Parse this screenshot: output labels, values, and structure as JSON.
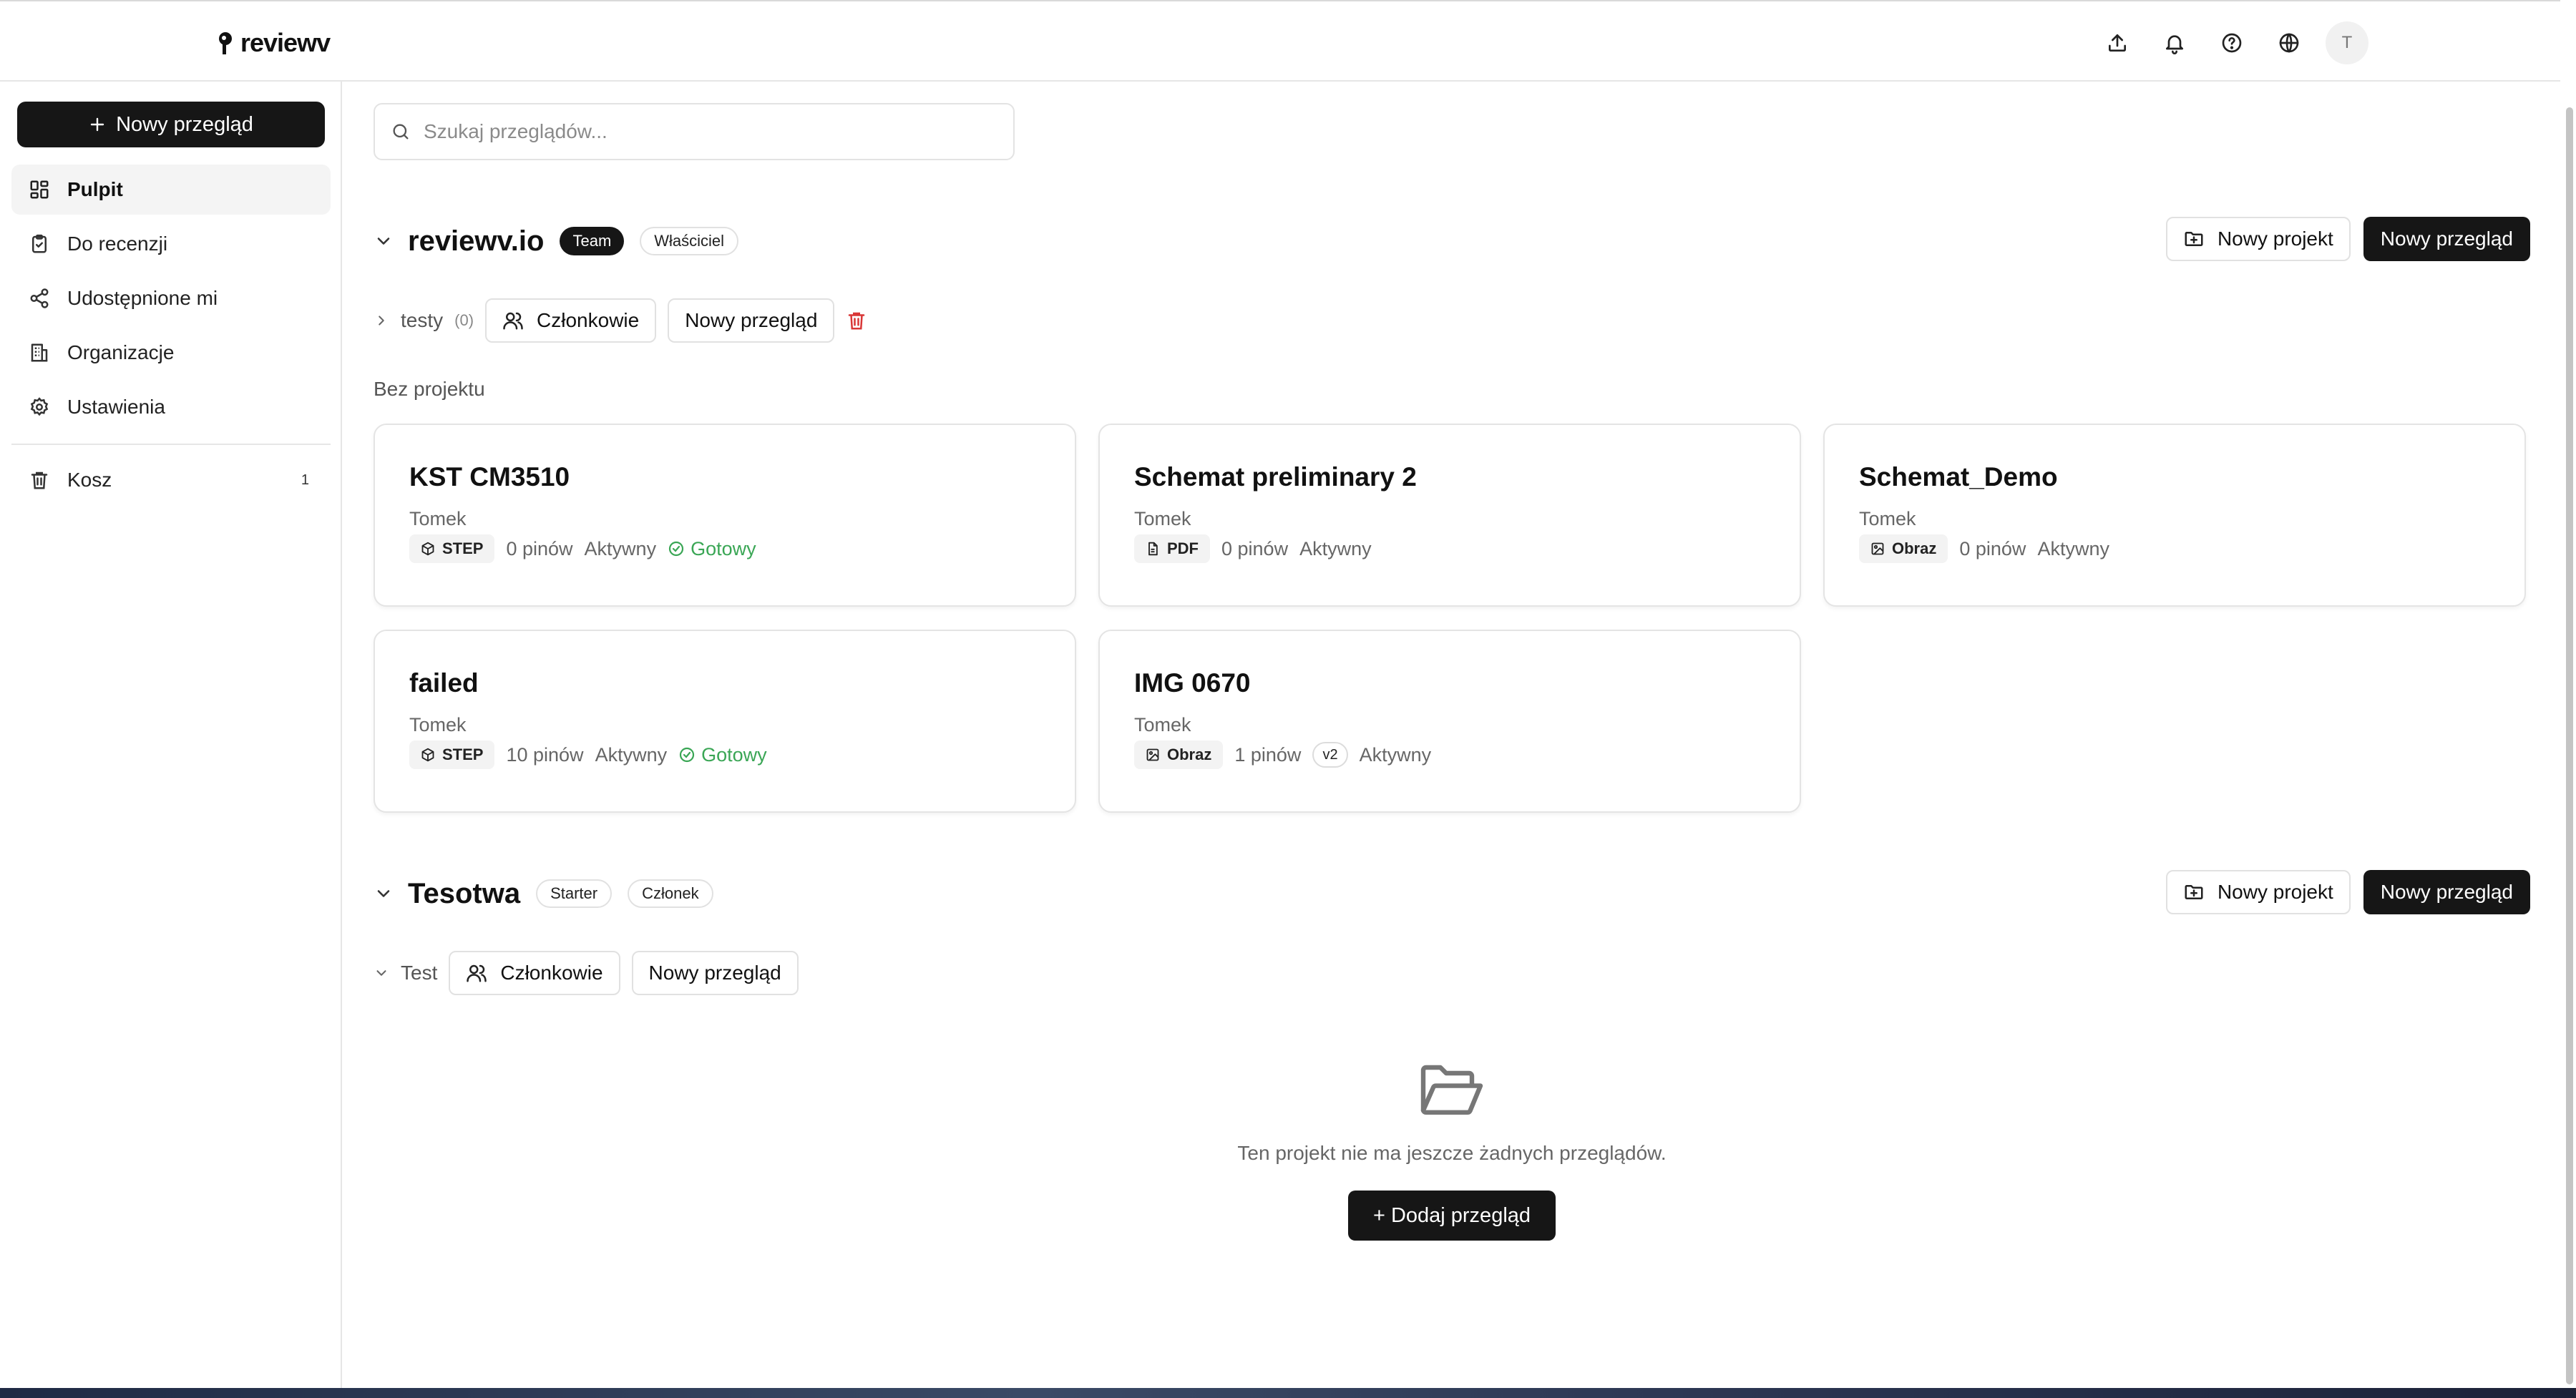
{
  "app": {
    "logo_text": "reviewv"
  },
  "header": {
    "avatar_initial": "T"
  },
  "sidebar": {
    "new_review_label": "Nowy przegląd",
    "items": [
      {
        "label": "Pulpit",
        "icon": "dashboard-icon",
        "active": true
      },
      {
        "label": "Do recenzji",
        "icon": "clipboard-icon"
      },
      {
        "label": "Udostępnione mi",
        "icon": "share-icon"
      },
      {
        "label": "Organizacje",
        "icon": "building-icon"
      },
      {
        "label": "Ustawienia",
        "icon": "gear-icon"
      }
    ],
    "trash": {
      "label": "Kosz",
      "count": "1",
      "icon": "trash-icon"
    }
  },
  "search": {
    "placeholder": "Szukaj przeglądów..."
  },
  "orgs": [
    {
      "name": "reviewv.io",
      "plan": "Team",
      "role": "Właściciel",
      "new_project_label": "Nowy projekt",
      "new_review_label": "Nowy przegląd",
      "project": {
        "name": "testy",
        "count": "(0)",
        "members_label": "Członkowie",
        "new_review_label": "Nowy przegląd"
      },
      "section_label": "Bez projektu",
      "cards": [
        {
          "title": "KST CM3510",
          "owner": "Tomek",
          "type": "STEP",
          "pins": "0 pinów",
          "status": "Aktywny",
          "ready": "Gotowy"
        },
        {
          "title": "Schemat preliminary 2",
          "owner": "Tomek",
          "type": "PDF",
          "pins": "0 pinów",
          "status": "Aktywny"
        },
        {
          "title": "Schemat_Demo",
          "owner": "Tomek",
          "type": "Obraz",
          "pins": "0 pinów",
          "status": "Aktywny"
        },
        {
          "title": "failed",
          "owner": "Tomek",
          "type": "STEP",
          "pins": "10 pinów",
          "status": "Aktywny",
          "ready": "Gotowy"
        },
        {
          "title": "IMG 0670",
          "owner": "Tomek",
          "type": "Obraz",
          "pins": "1 pinów",
          "version": "v2",
          "status": "Aktywny"
        }
      ]
    },
    {
      "name": "Tesotwa",
      "plan": "Starter",
      "role": "Członek",
      "new_project_label": "Nowy projekt",
      "new_review_label": "Nowy przegląd",
      "project": {
        "name": "Test",
        "members_label": "Członkowie",
        "new_review_label": "Nowy przegląd"
      },
      "empty_text": "Ten projekt nie ma jeszcze żadnych przeglądów.",
      "add_review_label": "+ Dodaj przegląd"
    }
  ],
  "colors": {
    "accent": "#161616",
    "ready": "#3aa655",
    "danger": "#d93636"
  }
}
